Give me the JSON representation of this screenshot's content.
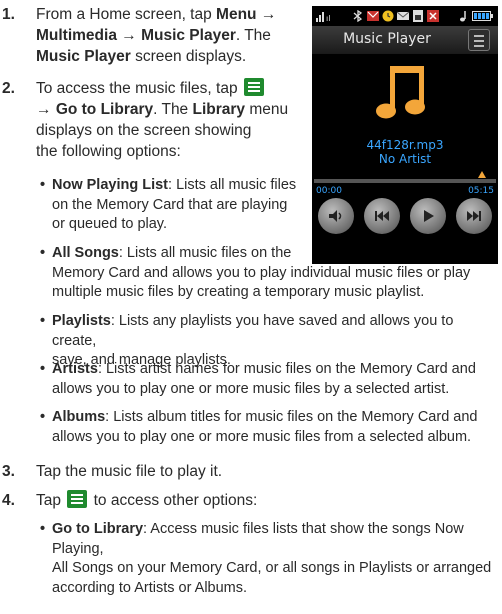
{
  "steps": [
    {
      "num": "1.",
      "parts": [
        "From a Home screen, tap ",
        "Menu",
        " → ",
        "Multimedia",
        " → ",
        "Music Player",
        ". The ",
        "Music Player",
        " screen displays."
      ]
    },
    {
      "num": "2.",
      "line1": "To access the music files, tap",
      "line2_arrow": "→",
      "line2_bold": "Go to Library",
      "line2_rest": ". The ",
      "line2_bold2": "Library",
      "line2_rest2": " menu",
      "line3": "displays on the screen showing",
      "line4": "the following options:"
    },
    {
      "num": "3.",
      "text": "Tap the music file to play it."
    },
    {
      "num": "4.",
      "text_before": "Tap",
      "text_after": "to access other options:"
    }
  ],
  "bullets_step2": [
    {
      "term": "Now Playing List",
      "lines": [
        ": Lists all music files",
        "on the Memory Card that are playing",
        "or queued to play."
      ]
    },
    {
      "term": "All Songs",
      "lines": [
        ": Lists all music files on the",
        "Memory Card and allows you to play individual music files or play",
        "multiple music files by creating a temporary music playlist."
      ]
    },
    {
      "term": "Playlists",
      "lines": [
        ": Lists any playlists you have saved and allows you to create,",
        "save, and manage playlists."
      ]
    },
    {
      "term": "Artists",
      "lines": [
        ": Lists artist names for music files on the Memory Card and",
        "allows you to play one or more music files by a selected artist."
      ]
    },
    {
      "term": "Albums",
      "lines": [
        ": Lists album titles for music files on the Memory Card and",
        "allows you to play one or more music files from a selected album."
      ]
    }
  ],
  "bullets_step4": [
    {
      "term": "Go to Library",
      "lines": [
        ": Access music files lists that show the songs Now Playing,",
        "All Songs on your Memory Card, or all songs in Playlists or arranged",
        "according to Artists or Albums."
      ]
    }
  ],
  "phone": {
    "title": "Music Player",
    "track": "44f128r.mp3",
    "artist": "No Artist",
    "elapsed": "00:00",
    "duration": "05:15",
    "progress": 0.0,
    "accent": "#3aa6ff",
    "note_color": "#f3a63a",
    "controls": [
      "volume-icon",
      "previous-icon",
      "play-icon",
      "next-icon"
    ]
  }
}
